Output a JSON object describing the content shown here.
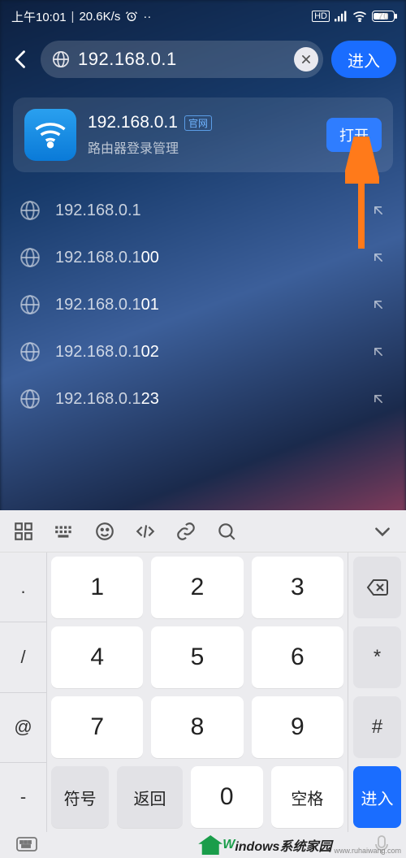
{
  "statusbar": {
    "time": "上午10:01",
    "speed": "20.6K/s",
    "battery_pct": 70,
    "battery_label": "70"
  },
  "address_bar": {
    "url": "192.168.0.1",
    "go_label": "进入"
  },
  "app_card": {
    "title": "192.168.0.1",
    "badge": "官网",
    "subtitle": "路由器登录管理",
    "open_label": "打开"
  },
  "suggestions": [
    {
      "prefix": "192.168.0.1",
      "tail": ""
    },
    {
      "prefix": "192.168.0.1",
      "tail": "00"
    },
    {
      "prefix": "192.168.0.1",
      "tail": "01"
    },
    {
      "prefix": "192.168.0.1",
      "tail": "02"
    },
    {
      "prefix": "192.168.0.1",
      "tail": "23"
    }
  ],
  "keyboard": {
    "left_punct": [
      ".",
      "/",
      "@",
      "-"
    ],
    "right_keys": {
      "backspace": "⌫",
      "star": "*",
      "hash": "#",
      "enter": "进入"
    },
    "numbers": [
      [
        "1",
        "2",
        "3"
      ],
      [
        "4",
        "5",
        "6"
      ],
      [
        "7",
        "8",
        "9"
      ]
    ],
    "bottom": {
      "symbols": "符号",
      "return": "返回",
      "zero": "0",
      "space": "空格",
      "enter": "进入"
    }
  },
  "watermark": {
    "w": "W",
    "rest": "indows系统家园",
    "sub": "www.ruhaiwang.com"
  }
}
